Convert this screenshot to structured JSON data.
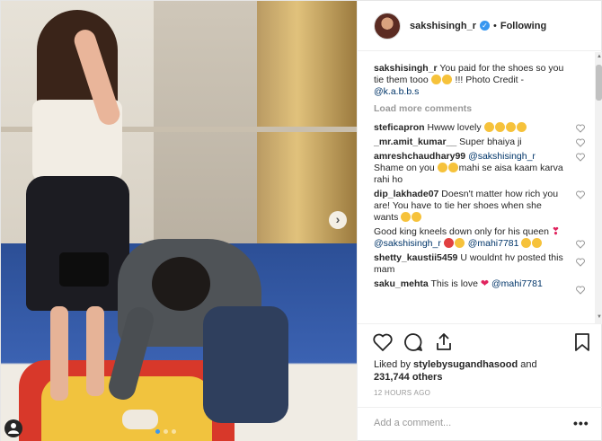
{
  "post": {
    "username": "sakshisingh_r",
    "follow_state": "Following",
    "dot_separator": "•"
  },
  "caption": {
    "username": "sakshisingh_r",
    "text": "You paid for the shoes so you tie them tooo",
    "suffix": " !!! Photo Credit -",
    "mention": "@k.a.b.b.s"
  },
  "load_more": "Load more comments",
  "comments": [
    {
      "username": "steficapron",
      "text": "Hwww lovely"
    },
    {
      "username": "_mr.amit_kumar__",
      "text": "Super bhaiya ji"
    },
    {
      "username": "amreshchaudhary99",
      "mention": "@sakshisingh_r",
      "text": "Shame on you",
      "text2": "mahi se aisa kaam karva rahi ho"
    },
    {
      "username": "dip_lakhade07",
      "text": "Doesn't matter how rich you are! You have to tie her shoes when she wants"
    },
    {
      "username": "",
      "text": "Good king kneels down only for his queen",
      "mention": "@sakshisingh_r",
      "mention2": "@mahi7781"
    },
    {
      "username": "shetty_kaustii5459",
      "text": "U wouldnt hv posted this mam"
    },
    {
      "username": "saku_mehta",
      "text": "This is love",
      "mention": "@mahi7781"
    }
  ],
  "likes": {
    "prefix": "Liked by",
    "user": "stylebysugandhasood",
    "middle": "and",
    "count": "231,744 others"
  },
  "timestamp": "12 HOURS AGO",
  "add_comment_placeholder": "Add a comment...",
  "more_options_label": "•••",
  "next_arrow_label": "›",
  "scroll_up_label": "▲",
  "scroll_down_label": "▼",
  "colors": {
    "link": "#003569",
    "verified": "#3897f0",
    "muted": "#999999",
    "text": "#262626"
  },
  "icons": [
    "verified-badge-icon",
    "heart-icon",
    "comment-icon",
    "share-icon",
    "bookmark-icon",
    "tagged-user-icon",
    "next-arrow-icon",
    "more-options-icon"
  ]
}
